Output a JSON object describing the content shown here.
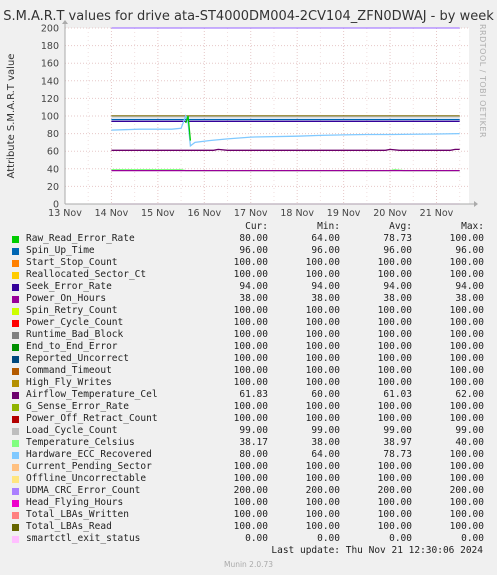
{
  "title": "S.M.A.R.T values for drive ata-ST4000DM004-2CV104_ZFN0DWAJ - by week",
  "side_credit": "RRDTOOL / TOBI OETIKER",
  "last_update": "Last update: Thu Nov 21 12:30:06 2024",
  "footer": "Munin 2.0.73",
  "legend_headers": {
    "cur": "Cur:",
    "min": "Min:",
    "avg": "Avg:",
    "max": "Max:"
  },
  "legend": [
    {
      "name": "Raw_Read_Error_Rate",
      "color": "#00cc00",
      "cur": "80.00",
      "min": "64.00",
      "avg": "78.73",
      "max": "100.00"
    },
    {
      "name": "Spin_Up_Time",
      "color": "#0066b3",
      "cur": "96.00",
      "min": "96.00",
      "avg": "96.00",
      "max": "96.00"
    },
    {
      "name": "Start_Stop_Count",
      "color": "#ff8000",
      "cur": "100.00",
      "min": "100.00",
      "avg": "100.00",
      "max": "100.00"
    },
    {
      "name": "Reallocated_Sector_Ct",
      "color": "#ffcc00",
      "cur": "100.00",
      "min": "100.00",
      "avg": "100.00",
      "max": "100.00"
    },
    {
      "name": "Seek_Error_Rate",
      "color": "#330099",
      "cur": "94.00",
      "min": "94.00",
      "avg": "94.00",
      "max": "94.00"
    },
    {
      "name": "Power_On_Hours",
      "color": "#990099",
      "cur": "38.00",
      "min": "38.00",
      "avg": "38.00",
      "max": "38.00"
    },
    {
      "name": "Spin_Retry_Count",
      "color": "#ccff00",
      "cur": "100.00",
      "min": "100.00",
      "avg": "100.00",
      "max": "100.00"
    },
    {
      "name": "Power_Cycle_Count",
      "color": "#ff0000",
      "cur": "100.00",
      "min": "100.00",
      "avg": "100.00",
      "max": "100.00"
    },
    {
      "name": "Runtime_Bad_Block",
      "color": "#808080",
      "cur": "100.00",
      "min": "100.00",
      "avg": "100.00",
      "max": "100.00"
    },
    {
      "name": "End_to_End_Error",
      "color": "#008f00",
      "cur": "100.00",
      "min": "100.00",
      "avg": "100.00",
      "max": "100.00"
    },
    {
      "name": "Reported_Uncorrect",
      "color": "#00487d",
      "cur": "100.00",
      "min": "100.00",
      "avg": "100.00",
      "max": "100.00"
    },
    {
      "name": "Command_Timeout",
      "color": "#b35a00",
      "cur": "100.00",
      "min": "100.00",
      "avg": "100.00",
      "max": "100.00"
    },
    {
      "name": "High_Fly_Writes",
      "color": "#b38f00",
      "cur": "100.00",
      "min": "100.00",
      "avg": "100.00",
      "max": "100.00"
    },
    {
      "name": "Airflow_Temperature_Cel",
      "color": "#6b006b",
      "cur": "61.83",
      "min": "60.00",
      "avg": "61.03",
      "max": "62.00"
    },
    {
      "name": "G_Sense_Error_Rate",
      "color": "#8fb300",
      "cur": "100.00",
      "min": "100.00",
      "avg": "100.00",
      "max": "100.00"
    },
    {
      "name": "Power_Off_Retract_Count",
      "color": "#b30000",
      "cur": "100.00",
      "min": "100.00",
      "avg": "100.00",
      "max": "100.00"
    },
    {
      "name": "Load_Cycle_Count",
      "color": "#bebebe",
      "cur": "99.00",
      "min": "99.00",
      "avg": "99.00",
      "max": "99.00"
    },
    {
      "name": "Temperature_Celsius",
      "color": "#80ff80",
      "cur": "38.17",
      "min": "38.00",
      "avg": "38.97",
      "max": "40.00"
    },
    {
      "name": "Hardware_ECC_Recovered",
      "color": "#80c9ff",
      "cur": "80.00",
      "min": "64.00",
      "avg": "78.73",
      "max": "100.00"
    },
    {
      "name": "Current_Pending_Sector",
      "color": "#ffc080",
      "cur": "100.00",
      "min": "100.00",
      "avg": "100.00",
      "max": "100.00"
    },
    {
      "name": "Offline_Uncorrectable",
      "color": "#ffe680",
      "cur": "100.00",
      "min": "100.00",
      "avg": "100.00",
      "max": "100.00"
    },
    {
      "name": "UDMA_CRC_Error_Count",
      "color": "#aa80ff",
      "cur": "200.00",
      "min": "200.00",
      "avg": "200.00",
      "max": "200.00"
    },
    {
      "name": "Head_Flying_Hours",
      "color": "#ee00cc",
      "cur": "100.00",
      "min": "100.00",
      "avg": "100.00",
      "max": "100.00"
    },
    {
      "name": "Total_LBAs_Written",
      "color": "#ff8080",
      "cur": "100.00",
      "min": "100.00",
      "avg": "100.00",
      "max": "100.00"
    },
    {
      "name": "Total_LBAs_Read",
      "color": "#666600",
      "cur": "100.00",
      "min": "100.00",
      "avg": "100.00",
      "max": "100.00"
    },
    {
      "name": "smartctl_exit_status",
      "color": "#ffbfff",
      "cur": "0.00",
      "min": "0.00",
      "avg": "0.00",
      "max": "0.00"
    }
  ],
  "chart_data": {
    "type": "line",
    "title": "S.M.A.R.T values for drive ata-ST4000DM004-2CV104_ZFN0DWAJ - by week",
    "ylabel": "Attribute S.M.A.R.T value",
    "xlabel": "",
    "ylim": [
      0,
      200
    ],
    "yticks": [
      0,
      20,
      40,
      60,
      80,
      100,
      120,
      140,
      160,
      180,
      200
    ],
    "xlim": [
      0,
      8.7
    ],
    "xticks": [
      {
        "label": "13 Nov",
        "x": 0
      },
      {
        "label": "14 Nov",
        "x": 1
      },
      {
        "label": "15 Nov",
        "x": 2
      },
      {
        "label": "16 Nov",
        "x": 3
      },
      {
        "label": "17 Nov",
        "x": 4
      },
      {
        "label": "18 Nov",
        "x": 5
      },
      {
        "label": "19 Nov",
        "x": 6
      },
      {
        "label": "20 Nov",
        "x": 7
      },
      {
        "label": "21 Nov",
        "x": 8
      }
    ],
    "grid": true,
    "series": [
      {
        "name": "UDMA_CRC_Error_Count",
        "color": "#aa80ff",
        "points": [
          [
            1.0,
            200
          ],
          [
            8.5,
            200
          ]
        ]
      },
      {
        "name": "Start_Stop_Count",
        "color": "#ff8000",
        "points": [
          [
            1.0,
            100
          ],
          [
            8.5,
            100
          ]
        ]
      },
      {
        "name": "Total_LBAs_Read",
        "color": "#666600",
        "points": [
          [
            1.0,
            100
          ],
          [
            8.5,
            100
          ]
        ]
      },
      {
        "name": "Load_Cycle_Count",
        "color": "#bebebe",
        "points": [
          [
            1.0,
            99
          ],
          [
            8.5,
            99
          ]
        ]
      },
      {
        "name": "Spin_Up_Time",
        "color": "#0066b3",
        "points": [
          [
            1.0,
            96
          ],
          [
            8.5,
            96
          ]
        ]
      },
      {
        "name": "Seek_Error_Rate",
        "color": "#330099",
        "points": [
          [
            1.0,
            94
          ],
          [
            8.5,
            94
          ]
        ]
      },
      {
        "name": "Hardware_ECC_Recovered",
        "color": "#80c9ff",
        "points": [
          [
            1.0,
            84
          ],
          [
            1.6,
            85
          ],
          [
            2.3,
            85
          ],
          [
            2.5,
            86
          ],
          [
            2.6,
            100
          ],
          [
            2.65,
            92
          ],
          [
            2.7,
            66
          ],
          [
            2.8,
            70
          ],
          [
            3.1,
            72
          ],
          [
            3.5,
            74
          ],
          [
            4.0,
            76
          ],
          [
            5.0,
            77
          ],
          [
            5.5,
            78
          ],
          [
            6.0,
            78.5
          ],
          [
            6.5,
            79
          ],
          [
            7.0,
            79
          ],
          [
            8.0,
            79.5
          ],
          [
            8.5,
            80
          ]
        ]
      },
      {
        "name": "Raw_Read_Error_Rate",
        "color": "#00cc00",
        "points": [
          [
            2.6,
            92
          ],
          [
            2.65,
            100
          ],
          [
            2.7,
            72
          ]
        ]
      },
      {
        "name": "Airflow_Temperature_Cel",
        "color": "#6b006b",
        "points": [
          [
            1.0,
            61
          ],
          [
            3.2,
            61
          ],
          [
            3.3,
            62
          ],
          [
            3.5,
            61
          ],
          [
            6.9,
            61
          ],
          [
            7.0,
            62
          ],
          [
            7.2,
            61
          ],
          [
            8.3,
            61
          ],
          [
            8.4,
            62
          ],
          [
            8.5,
            62
          ]
        ]
      },
      {
        "name": "Temperature_Celsius",
        "color": "#80ff80",
        "points": [
          [
            1.0,
            39
          ],
          [
            2.5,
            39
          ],
          [
            2.6,
            38
          ],
          [
            7.0,
            38
          ],
          [
            7.1,
            39
          ],
          [
            7.3,
            38
          ],
          [
            8.5,
            38
          ]
        ]
      },
      {
        "name": "Power_On_Hours",
        "color": "#990099",
        "points": [
          [
            1.0,
            38
          ],
          [
            8.5,
            38
          ]
        ]
      },
      {
        "name": "smartctl_exit_status",
        "color": "#ffbfff",
        "points": [
          [
            1.0,
            0
          ],
          [
            8.5,
            0
          ]
        ]
      }
    ]
  }
}
